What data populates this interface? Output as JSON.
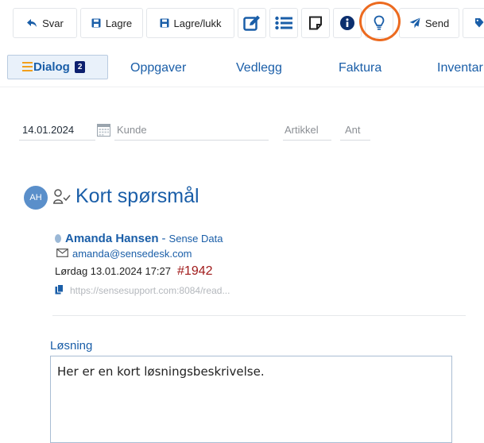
{
  "toolbar": {
    "reply_label": "Svar",
    "save_label": "Lagre",
    "save_close_label": "Lagre/lukk",
    "send_label": "Send"
  },
  "tabs": [
    {
      "label": "Dialog",
      "badge": "2",
      "active": true
    },
    {
      "label": "Oppgaver"
    },
    {
      "label": "Vedlegg"
    },
    {
      "label": "Faktura"
    },
    {
      "label": "Inventar"
    }
  ],
  "filters": {
    "date": "14.01.2024",
    "customer_placeholder": "Kunde",
    "article_placeholder": "Artikkel",
    "qty_placeholder": "Ant"
  },
  "message": {
    "avatar_initials": "AH",
    "title": "Kort spørsmål",
    "sender_name": "Amanda Hansen",
    "sender_separator": "-",
    "sender_org": "Sense Data",
    "email": "amanda@sensedesk.com",
    "date": "Lørdag 13.01.2024 17:27",
    "ticket": "#1942",
    "url": "https://sensesupport.com:8084/read..."
  },
  "solution": {
    "label": "Løsning",
    "text": "Her er en kort løsningsbeskrivelse."
  },
  "colors": {
    "accent": "#1a5ea8",
    "highlight_ring": "#ec6a1f",
    "ticket": "#a01a1a",
    "badge": "#0c1f6e"
  }
}
